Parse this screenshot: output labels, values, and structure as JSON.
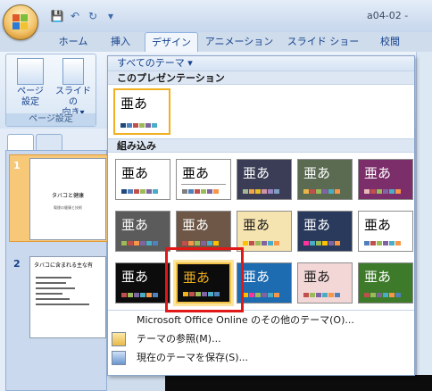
{
  "window": {
    "doc_title": "a04-02 -"
  },
  "tabs": [
    {
      "label": "ホーム"
    },
    {
      "label": "挿入"
    },
    {
      "label": "デザイン"
    },
    {
      "label": "アニメーション"
    },
    {
      "label": "スライド ショー"
    },
    {
      "label": "校閲"
    }
  ],
  "ribbon": {
    "page_setup_label": "ページ設定",
    "page_setup_button": "ページ\n設定",
    "orientation_button": "スライドの\n向き▾",
    "group_label": "ページ設定"
  },
  "slides": [
    {
      "num": "1",
      "title": "タバコと健康",
      "subtitle": "喫煙の健康と技術"
    },
    {
      "num": "2",
      "title": "タバコに含まれる主な有",
      "bullets": [
        "・",
        "・",
        "・",
        "・",
        "・",
        "・"
      ]
    }
  ],
  "gallery": {
    "header": "すべてのテーマ ▾",
    "section_current": "このプレゼンテーション",
    "section_builtin": "組み込み",
    "theme_text": "亜あ",
    "current_theme": {
      "bg": "#ffffff",
      "text": "#000000",
      "border": "#f0b020",
      "swatches": [
        "#1f497d",
        "#4f81bd",
        "#c0504d",
        "#9bbb59",
        "#8064a2",
        "#4bacc6"
      ]
    },
    "themes": [
      {
        "bg": "#ffffff",
        "text": "#000000",
        "swatches": [
          "#1f497d",
          "#4f81bd",
          "#c0504d",
          "#9bbb59",
          "#8064a2",
          "#4bacc6"
        ]
      },
      {
        "bg": "#ffffff",
        "text": "#000000",
        "line": true,
        "swatches": [
          "#7f7f7f",
          "#4f81bd",
          "#c0504d",
          "#9bbb59",
          "#8064a2",
          "#f79646"
        ]
      },
      {
        "bg": "#3a3d55",
        "text": "#ffffff",
        "swatches": [
          "#a5b592",
          "#f3a447",
          "#e7bc29",
          "#d092a7",
          "#9c85c0",
          "#809ec2"
        ]
      },
      {
        "bg": "#5a6b52",
        "text": "#ffffff",
        "swatches": [
          "#e8b54d",
          "#c0504d",
          "#9bbb59",
          "#8064a2",
          "#4bacc6",
          "#f79646"
        ]
      },
      {
        "bg": "#7c2e6a",
        "text": "#ffffff",
        "swatches": [
          "#e6b9b8",
          "#c0504d",
          "#9bbb59",
          "#8064a2",
          "#4bacc6",
          "#f79646"
        ]
      },
      {
        "bg": "#5b5b5b",
        "text": "#ffffff",
        "swatches": [
          "#9bbb59",
          "#c0504d",
          "#f79646",
          "#8064a2",
          "#4bacc6",
          "#4f81bd"
        ]
      },
      {
        "bg": "#6e5746",
        "text": "#ffffff",
        "swatches": [
          "#c0504d",
          "#f79646",
          "#9bbb59",
          "#8064a2",
          "#4bacc6",
          "#ffc000"
        ]
      },
      {
        "bg": "#f5e3b0",
        "text": "#1a1a1a",
        "swatches": [
          "#ffc000",
          "#c0504d",
          "#9bbb59",
          "#8064a2",
          "#4bacc6",
          "#f79646"
        ]
      },
      {
        "bg": "#2a3a5c",
        "text": "#ffffff",
        "swatches": [
          "#ff3399",
          "#4bacc6",
          "#9bbb59",
          "#ffc000",
          "#8064a2",
          "#f79646"
        ]
      },
      {
        "bg": "#ffffff",
        "text": "#000000",
        "swatches": [
          "#4f81bd",
          "#c0504d",
          "#9bbb59",
          "#8064a2",
          "#4bacc6",
          "#f79646"
        ]
      },
      {
        "bg": "#0c0c0c",
        "text": "#ffffff",
        "swatches": [
          "#c0504d",
          "#9bbb59",
          "#8064a2",
          "#4bacc6",
          "#f79646",
          "#4f81bd"
        ]
      },
      {
        "bg": "#0c0c0c",
        "text": "#f0b020",
        "selected": true,
        "swatches": [
          "#f0b020",
          "#c0504d",
          "#9bbb59",
          "#8064a2",
          "#4bacc6",
          "#4f81bd"
        ]
      },
      {
        "bg": "#1d6bb0",
        "text": "#ffffff",
        "swatches": [
          "#ffc000",
          "#ff3399",
          "#9bbb59",
          "#8064a2",
          "#4bacc6",
          "#f79646"
        ]
      },
      {
        "bg": "#f3d7d7",
        "text": "#1a1a1a",
        "swatches": [
          "#c0504d",
          "#9bbb59",
          "#8064a2",
          "#4bacc6",
          "#f79646",
          "#4f81bd"
        ]
      },
      {
        "bg": "#3d7a2a",
        "text": "#ffffff",
        "swatches": [
          "#c0504d",
          "#9bbb59",
          "#8064a2",
          "#4bacc6",
          "#f79646",
          "#4f81bd"
        ]
      }
    ],
    "menu": [
      {
        "label": "Microsoft Office Online のその他のテーマ(O)...",
        "icon": "none"
      },
      {
        "label": "テーマの参照(M)...",
        "icon": "folder-icon"
      },
      {
        "label": "現在のテーマを保存(S)...",
        "icon": "save-theme-icon"
      }
    ]
  }
}
